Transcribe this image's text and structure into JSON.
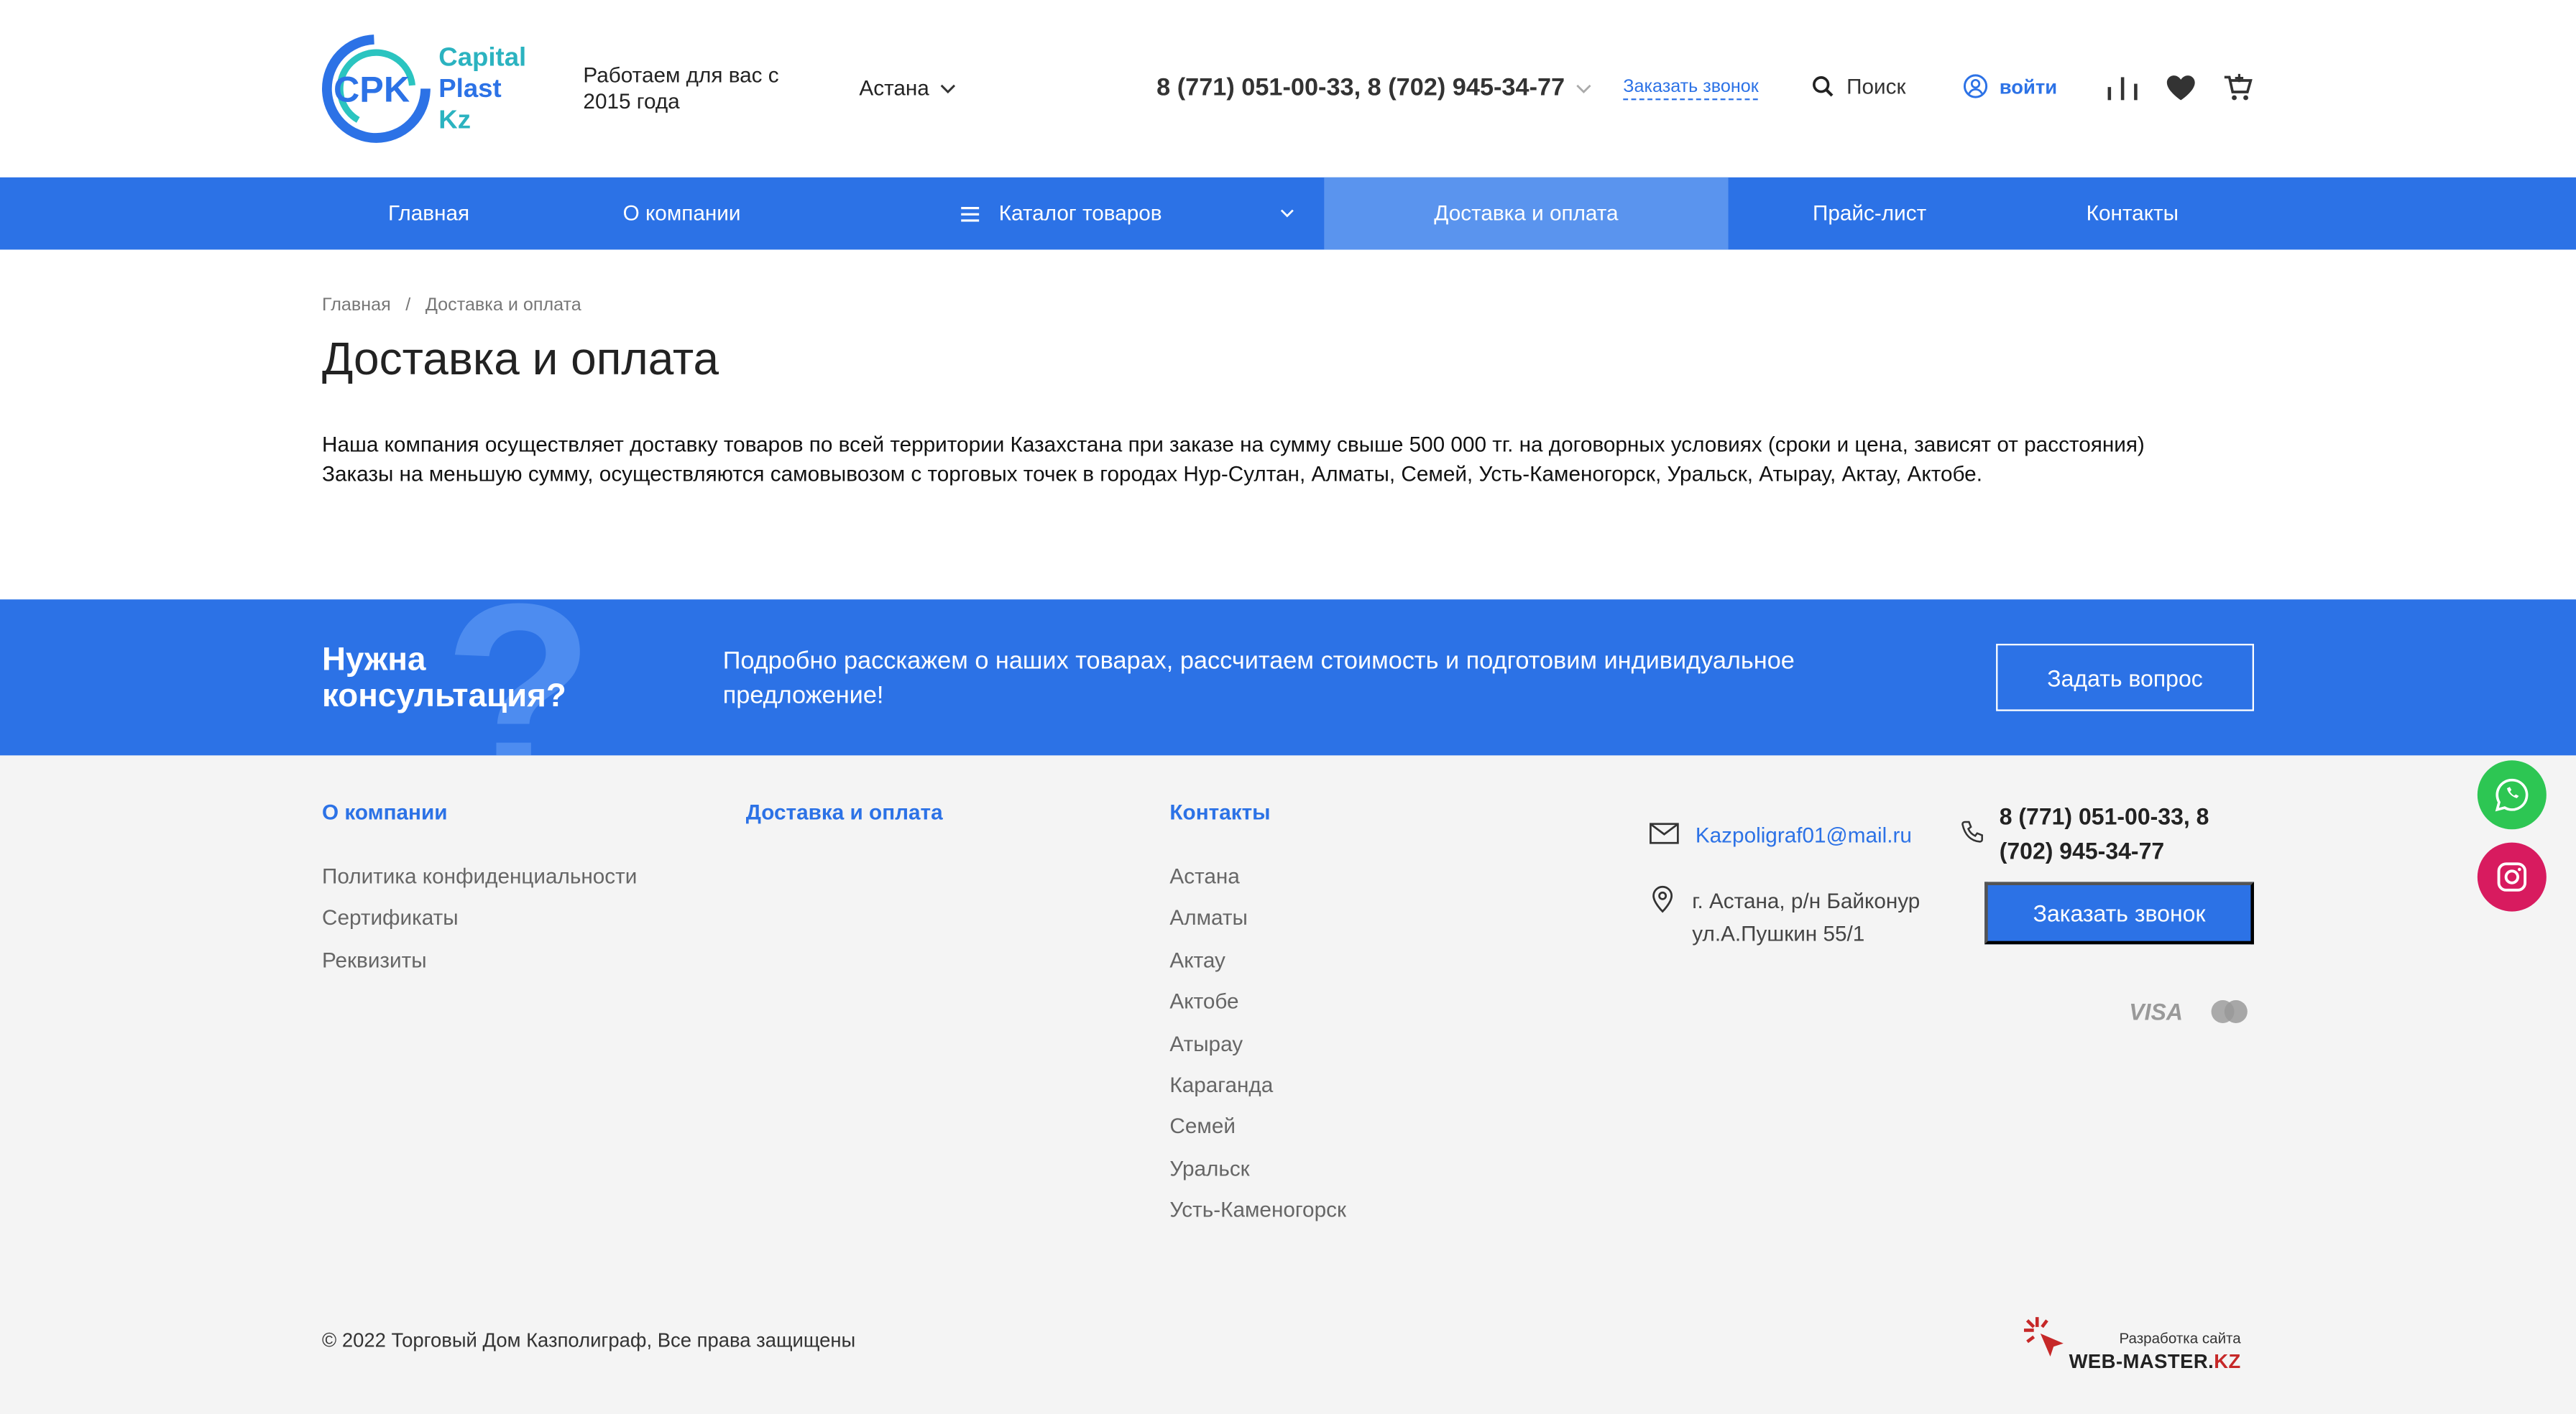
{
  "header": {
    "logo": {
      "line1": "Capital",
      "line2": "Plast",
      "line3": "Kz",
      "mark": "CPK"
    },
    "tagline": "Работаем для вас с 2015 года",
    "city": "Астана",
    "phones": "8 (771) 051-00-33, 8 (702) 945-34-77",
    "callback_link": "Заказать звонок",
    "search_label": "Поиск",
    "login_label": "войти"
  },
  "nav": {
    "items": [
      "Главная",
      "О компании",
      "Каталог товаров",
      "Доставка и оплата",
      "Прайс-лист",
      "Контакты"
    ],
    "active": "Доставка и оплата"
  },
  "breadcrumb": {
    "home": "Главная",
    "sep": "/",
    "current": "Доставка и оплата"
  },
  "page": {
    "title": "Доставка и оплата",
    "para1": "Наша компания осуществляет доставку товаров по всей территории Казахстана при заказе на сумму свыше 500 000 тг. на договорных условиях (сроки и цена, зависят от расстояния)",
    "para2": "Заказы на меньшую сумму, осуществляются самовывозом с торговых точек в городах Нур-Султан, Алматы, Семей, Усть-Каменогорск, Уральск, Атырау, Актау, Актобе."
  },
  "consult": {
    "title": "Нужна консультация?",
    "text": "Подробно расскажем о наших товарах, рассчитаем стоимость и подготовим индивидуальное предложение!",
    "button": "Задать вопрос"
  },
  "footer": {
    "col1": {
      "title": "О компании",
      "items": [
        "Политика конфиденциальности",
        "Сертификаты",
        "Реквизиты"
      ]
    },
    "col2": {
      "title": "Доставка и оплата"
    },
    "col3": {
      "title": "Контакты",
      "items": [
        "Астана",
        "Алматы",
        "Актау",
        "Актобе",
        "Атырау",
        "Караганда",
        "Семей",
        "Уральск",
        "Усть-Каменогорск"
      ]
    },
    "email": "Kazpoligraf01@mail.ru",
    "address": "г. Астана, р/н Байконур ул.А.Пушкин 55/1",
    "phone": "8 (771) 051-00-33, 8 (702) 945-34-77",
    "call_button": "Заказать звонок",
    "visa": "VISA",
    "copyright": "© 2022 Торговый Дом Казполиграф, Все права защищены",
    "dev_small": "Разработка сайта",
    "dev_big": "WEB-MASTER.",
    "dev_kz": "KZ"
  },
  "colors": {
    "accent": "#2c72e6",
    "nav_active": "#5a94ee",
    "whatsapp": "#2dc653",
    "instagram": "#d81b5f"
  },
  "icons": [
    "chevron-down-icon",
    "search-icon",
    "user-icon",
    "compare-icon",
    "heart-icon",
    "cart-icon",
    "menu-icon",
    "mail-icon",
    "phone-icon",
    "location-icon",
    "mastercard-icon",
    "whatsapp-icon",
    "instagram-icon"
  ]
}
